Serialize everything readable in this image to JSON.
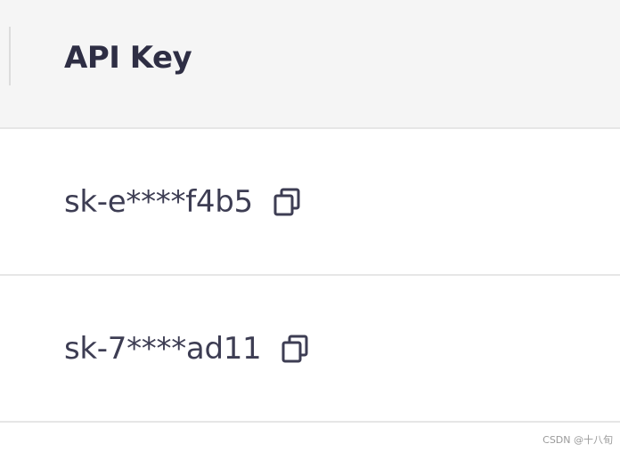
{
  "table": {
    "header": {
      "api_key_label": "API Key"
    },
    "rows": [
      {
        "key": "sk-e****f4b5",
        "copy_icon": "copy-icon"
      },
      {
        "key": "sk-7****ad11",
        "copy_icon": "copy-icon"
      }
    ]
  },
  "watermark": {
    "text": "CSDN @十八旬"
  },
  "colors": {
    "header_bg": "#f5f5f5",
    "text": "#3d3d53",
    "border": "#e6e6e6"
  }
}
